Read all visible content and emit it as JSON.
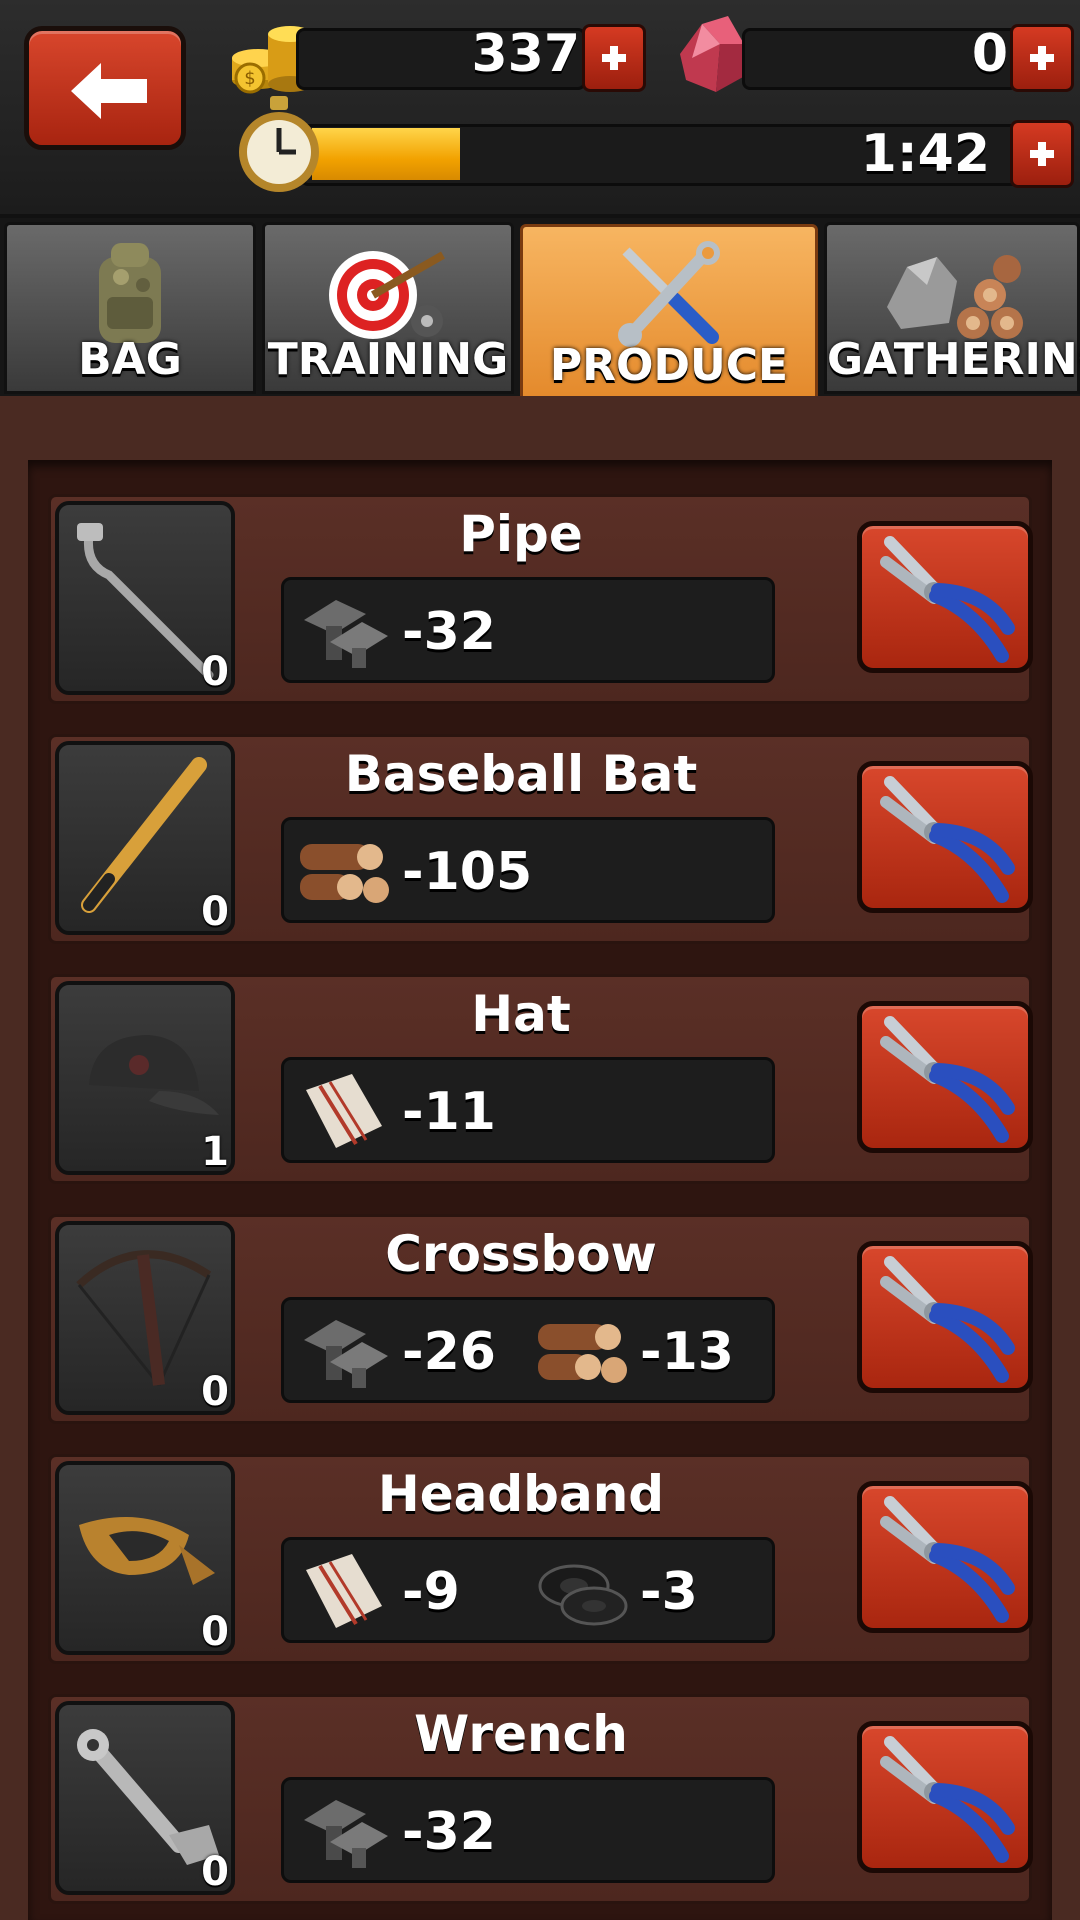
{
  "resources": {
    "coins": "337",
    "gems": "0",
    "timer": "1:42",
    "timer_progress": 0.25
  },
  "tabs": [
    {
      "label": "BAG",
      "icon": "backpack-icon",
      "active": false
    },
    {
      "label": "TRAINING",
      "icon": "target-icon",
      "active": false
    },
    {
      "label": "PRODUCE",
      "icon": "tools-icon",
      "active": true
    },
    {
      "label": "GATHERING",
      "icon": "stone-wood-icon",
      "active": false
    }
  ],
  "items": [
    {
      "name": "Pipe",
      "count": "0",
      "icon": "pipe-icon",
      "costs": [
        {
          "resource": "metal-icon",
          "amount": "-32"
        }
      ]
    },
    {
      "name": "Baseball Bat",
      "count": "0",
      "icon": "baseball-bat-icon",
      "costs": [
        {
          "resource": "wood-icon",
          "amount": "-105"
        }
      ]
    },
    {
      "name": "Hat",
      "count": "1",
      "icon": "cap-icon",
      "costs": [
        {
          "resource": "cloth-icon",
          "amount": "-11"
        }
      ]
    },
    {
      "name": "Crossbow",
      "count": "0",
      "icon": "crossbow-icon",
      "costs": [
        {
          "resource": "metal-icon",
          "amount": "-26"
        },
        {
          "resource": "wood-icon",
          "amount": "-13"
        }
      ]
    },
    {
      "name": "Headband",
      "count": "0",
      "icon": "headband-icon",
      "costs": [
        {
          "resource": "cloth-icon",
          "amount": "-9"
        },
        {
          "resource": "tire-icon",
          "amount": "-3"
        }
      ]
    },
    {
      "name": "Wrench",
      "count": "0",
      "icon": "wrench-icon",
      "costs": [
        {
          "resource": "metal-icon",
          "amount": "-32"
        }
      ]
    }
  ],
  "colors": {
    "button_red": "#c5351c",
    "active_tab": "#eb9a3e",
    "panel": "#4a2a22",
    "progress": "#f2a200"
  }
}
